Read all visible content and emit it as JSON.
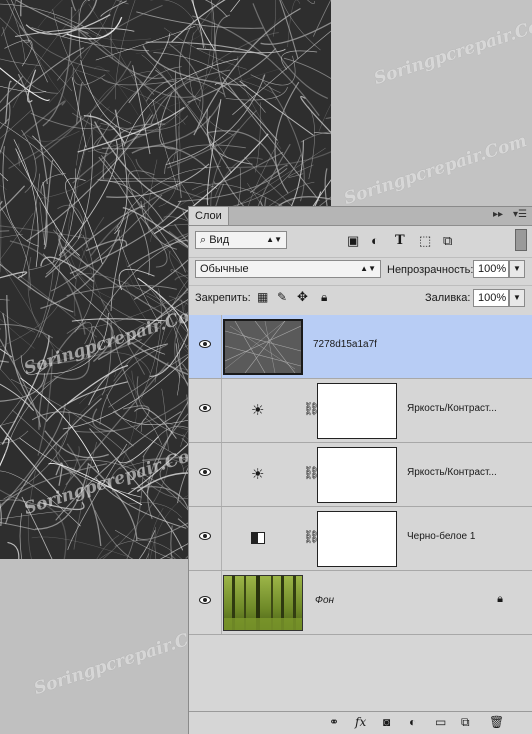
{
  "colors": {
    "workspace": "#c0c0c0",
    "panel": "#d6d6d6",
    "selected_layer": "#b8cdf5"
  },
  "watermark": "Soringpcrepair.Com",
  "layers_panel": {
    "tab_label": "Слои",
    "collapse_icon": "double-arrow-icon",
    "menu_icon": "panel-menu-icon",
    "filter": {
      "label": "Вид",
      "icons": [
        "image-filter-icon",
        "adjustment-filter-icon",
        "type-filter-icon",
        "shape-filter-icon",
        "smart-object-filter-icon"
      ]
    },
    "blend_mode": "Обычные",
    "opacity_label": "Непрозрачность:",
    "opacity_value": "100%",
    "lock_label": "Закрепить:",
    "lock_icons": [
      "lock-transparency-icon",
      "lock-pixels-icon",
      "lock-position-icon",
      "lock-all-icon"
    ],
    "fill_label": "Заливка:",
    "fill_value": "100%",
    "layers": [
      {
        "name": "7278d15a1a7f",
        "type": "image",
        "selected": true
      },
      {
        "name": "Яркость/Контраст...",
        "type": "adjustment",
        "icon": "brightness-icon"
      },
      {
        "name": "Яркость/Контраст...",
        "type": "adjustment",
        "icon": "brightness-icon"
      },
      {
        "name": "Черно-белое 1",
        "type": "adjustment",
        "icon": "black-white-icon"
      },
      {
        "name": "Фон",
        "type": "background",
        "locked": true
      }
    ],
    "footer_icons": [
      "link-layers-icon",
      "fx-icon",
      "add-mask-icon",
      "new-adjustment-icon",
      "new-group-icon",
      "new-layer-icon",
      "delete-layer-icon"
    ],
    "footer_fx": "fx"
  }
}
